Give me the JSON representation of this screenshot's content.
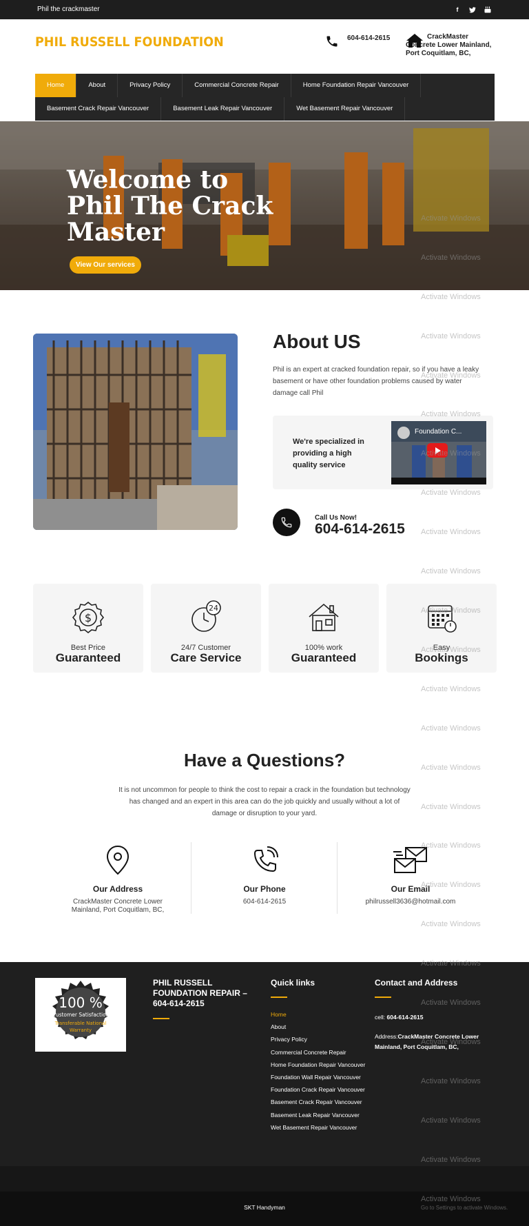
{
  "topbar": {
    "tagline": "Phil the crackmaster",
    "social": [
      {
        "icon": "facebook-icon",
        "glyph": "f"
      },
      {
        "icon": "twitter-icon",
        "glyph": "t"
      },
      {
        "icon": "youtube-icon",
        "glyph": "▶"
      }
    ]
  },
  "header": {
    "logo": "PHIL RUSSELL FOUNDATION",
    "phone": "604-614-2615",
    "address": "CrackMaster Concrete Lower Mainland, Port Coquitlam, BC,"
  },
  "nav": {
    "row1": [
      "Home",
      "About",
      "Privacy Policy",
      "Commercial Concrete Repair",
      "Home Foundation Repair Vancouver"
    ],
    "row2": [
      "Basement Crack Repair Vancouver",
      "Basement Leak Repair Vancouver",
      "Wet Basement Repair Vancouver"
    ]
  },
  "hero": {
    "title": "Welcome to Phil The Crack Master",
    "cta": "View Our services"
  },
  "about": {
    "title": "About US",
    "text": "Phil is an expert at cracked foundation repair, so if you have a leaky basement or have other foundation problems caused by water damage call Phil",
    "specialized": "We're specialized in providing a high quality service",
    "video_title": "Foundation C...",
    "call_label": "Call Us Now!",
    "call_number": "604-614-2615"
  },
  "features": [
    {
      "icon": "dollar-badge-icon",
      "line1": "Best Price",
      "line2": "Guaranteed"
    },
    {
      "icon": "clock-24-icon",
      "line1": "24/7 Customer",
      "line2": "Care Service"
    },
    {
      "icon": "house-icon",
      "line1": "100% work",
      "line2": "Guaranteed"
    },
    {
      "icon": "calendar-icon",
      "line1": "Easy",
      "line2": "Bookings"
    }
  ],
  "questions": {
    "title": "Have a Questions?",
    "text": "It is not uncommon for people to think the cost to repair a crack in the foundation but technology has changed and an expert in this area can do the job quickly and usually without a lot of damage or disruption to your yard."
  },
  "contacts": [
    {
      "icon": "map-pin-icon",
      "title": "Our Address",
      "value": "CrackMaster Concrete Lower Mainland, Port Coquitlam, BC,"
    },
    {
      "icon": "phone-icon",
      "title": "Our Phone",
      "value": "604-614-2615"
    },
    {
      "icon": "envelopes-icon",
      "title": "Our Email",
      "value": "philrussell3636@hotmail.com"
    }
  ],
  "footer": {
    "badge_pct": "100 %",
    "badge_line1": "Customer Satisfaction",
    "badge_line2": "Transferable National",
    "badge_line3": "Warranty",
    "company": "PHIL RUSSELL FOUNDATION REPAIR – 604-614-2615",
    "quick_links_title": "Quick links",
    "quick_links": [
      "Home",
      "About",
      "Privacy Policy",
      "Commercial Concrete Repair",
      "Home Foundation Repair Vancouver",
      "Foundation Wall Repair Vancouver",
      "Foundation Crack Repair Vancouver",
      "Basement Crack Repair Vancouver",
      "Basement Leak Repair Vancouver",
      "Wet Basement Repair Vancouver"
    ],
    "contact_title": "Contact and Address",
    "cell_label": "cell: ",
    "cell_value": "604-614-2615",
    "address_label": "Address:",
    "address_value": "CrackMaster Concrete Lower Mainland, Port Coquitlam, BC,",
    "credit": "SKT Handyman"
  },
  "watermark": {
    "text": "Activate Windows",
    "sub": "Go to Settings to activate Windows."
  },
  "colors": {
    "accent": "#f0ab0a",
    "dark": "#1f1f1f"
  }
}
